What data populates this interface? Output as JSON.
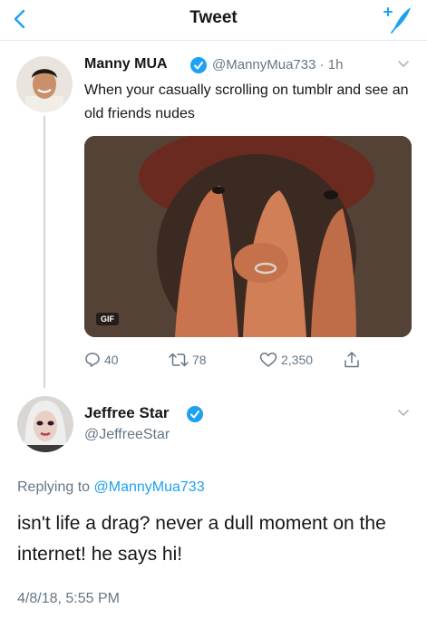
{
  "header": {
    "title": "Tweet"
  },
  "thread": [
    {
      "name": "Manny MUA",
      "handle_time": "@MannyMua733 · 1h",
      "text": "When your casually scrolling on tumblr and see an old friends nudes",
      "media_badge": "GIF",
      "actions": {
        "replies": "40",
        "retweets": "78",
        "likes": "2,350"
      }
    },
    {
      "name": "Jeffree Star",
      "handle": "@JeffreeStar",
      "replying_prefix": "Replying to",
      "replying_to": "@MannyMua733",
      "text": "isn't life a drag? never a dull moment on the internet! he says hi!",
      "timestamp": "4/8/18, 5:55 PM"
    }
  ],
  "colors": {
    "accent": "#1da1f2",
    "muted": "#657786",
    "divider": "#e1e8ed"
  },
  "icons": [
    "back-chevron-icon",
    "compose-icon",
    "verified-badge-icon",
    "chevron-down-icon",
    "reply-icon",
    "retweet-icon",
    "like-icon",
    "share-icon"
  ]
}
